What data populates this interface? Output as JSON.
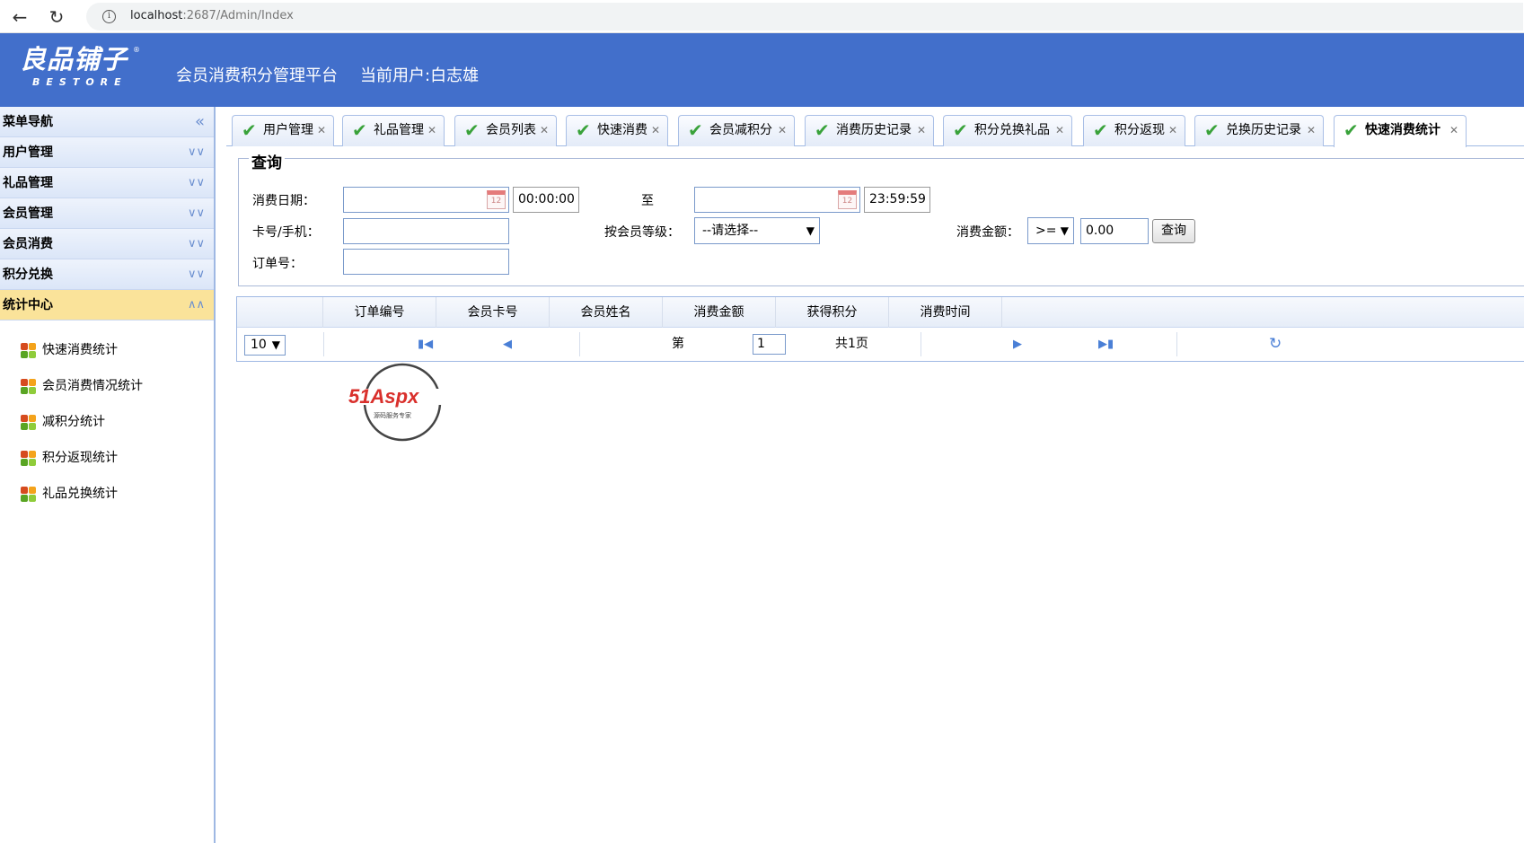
{
  "browser": {
    "back": "←",
    "reload": "↻",
    "info": "i",
    "url_host": "localhost",
    "url_path": ":2687/Admin/Index"
  },
  "header": {
    "logo_cn": "良品铺子",
    "logo_en": "BESTORE",
    "logo_reg": "®",
    "platform": "会员消费积分管理平台",
    "current_user": "当前用户:白志雄"
  },
  "sidebar": {
    "title": "菜单导航",
    "collapse_glyph": "«",
    "sections": [
      "用户管理",
      "礼品管理",
      "会员管理",
      "会员消费",
      "积分兑换"
    ],
    "active_section": "统计中心",
    "items": [
      "快速消费统计",
      "会员消费情况统计",
      "减积分统计",
      "积分返现统计",
      "礼品兑换统计"
    ]
  },
  "tabs": [
    {
      "label": "用户管理"
    },
    {
      "label": "礼品管理"
    },
    {
      "label": "会员列表"
    },
    {
      "label": "快速消费"
    },
    {
      "label": "会员减积分"
    },
    {
      "label": "消费历史记录"
    },
    {
      "label": "积分兑换礼品"
    },
    {
      "label": "积分返现"
    },
    {
      "label": "兑换历史记录"
    },
    {
      "label": "快速消费统计"
    }
  ],
  "query": {
    "legend": "查询",
    "date_label": "消费日期：",
    "date_from": "",
    "time_from": "00:00:00",
    "to_label": "至",
    "date_to": "",
    "time_to": "23:59:59",
    "card_label": "卡号/手机：",
    "card_value": "",
    "level_label": "按会员等级：",
    "level_selected": "--请选择--",
    "amount_label": "消费金额：",
    "op_selected": ">=",
    "amount_value": "0.00",
    "search_button": "查询",
    "order_label": "订单号：",
    "order_value": ""
  },
  "table": {
    "columns": [
      "订单编号",
      "会员卡号",
      "会员姓名",
      "消费金额",
      "获得积分",
      "消费时间"
    ],
    "rows": []
  },
  "pager": {
    "page_size": "10",
    "page_label": "第",
    "page_value": "1",
    "total": "共1页"
  },
  "watermark": {
    "brand": "51Aspx",
    "sub": "源码服务专家"
  }
}
